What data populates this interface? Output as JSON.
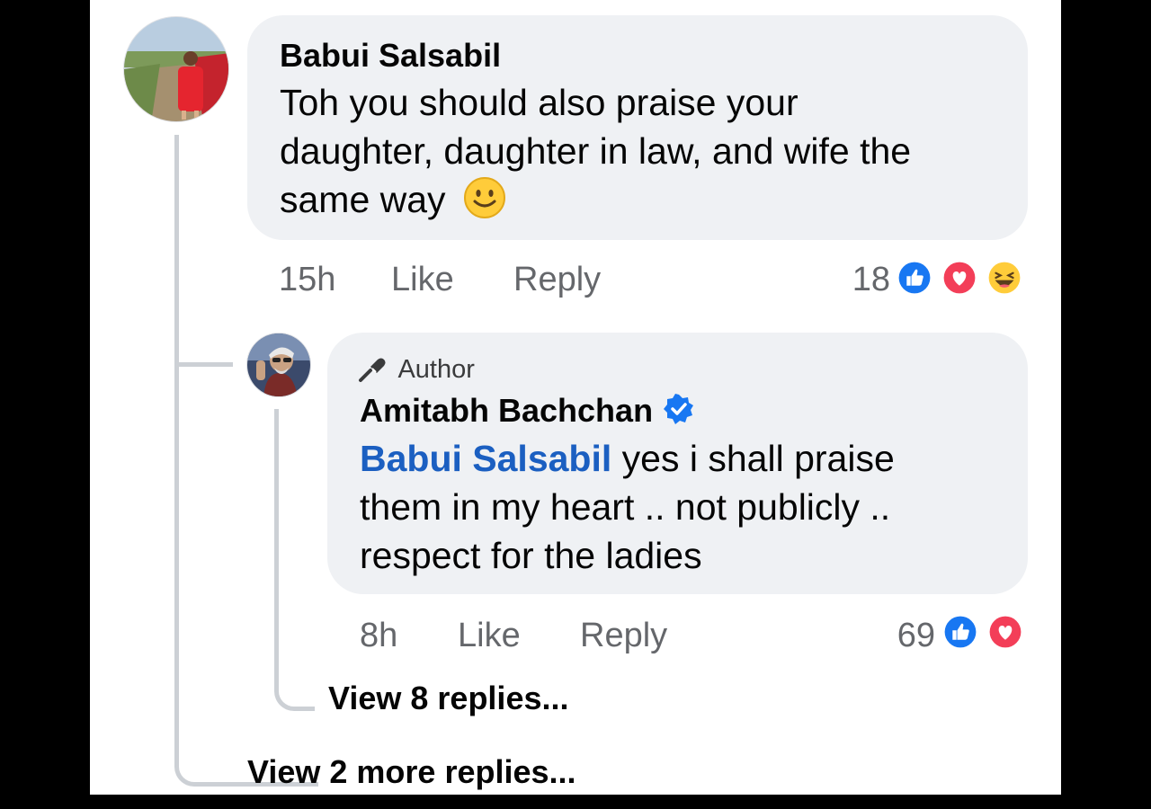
{
  "comment": {
    "author": "Babui Salsabil",
    "text_lines": [
      "Toh you should also praise your",
      "daughter, daughter in law, and wife the",
      "same way"
    ],
    "time": "15h",
    "like_label": "Like",
    "reply_label": "Reply",
    "reaction_count": "18",
    "reactions": [
      "like-icon",
      "love-icon",
      "haha-icon"
    ]
  },
  "reply": {
    "badge": "Author",
    "author": "Amitabh Bachchan",
    "verified": true,
    "mention": "Babui Salsabil",
    "text_first": "yes i shall praise",
    "text_lines": [
      "them in my heart .. not publicly ..",
      "respect for the ladies"
    ],
    "time": "8h",
    "like_label": "Like",
    "reply_label": "Reply",
    "reaction_count": "69",
    "reactions": [
      "like-icon",
      "love-icon"
    ]
  },
  "view_replies_nested": "View 8 replies...",
  "view_more_replies": "View 2 more replies...",
  "colors": {
    "bubble": "#eff1f4",
    "like_blue": "#1877f2",
    "love_red": "#f33e58",
    "mention_blue": "#1b5fc1",
    "verified_blue": "#1877f2"
  }
}
